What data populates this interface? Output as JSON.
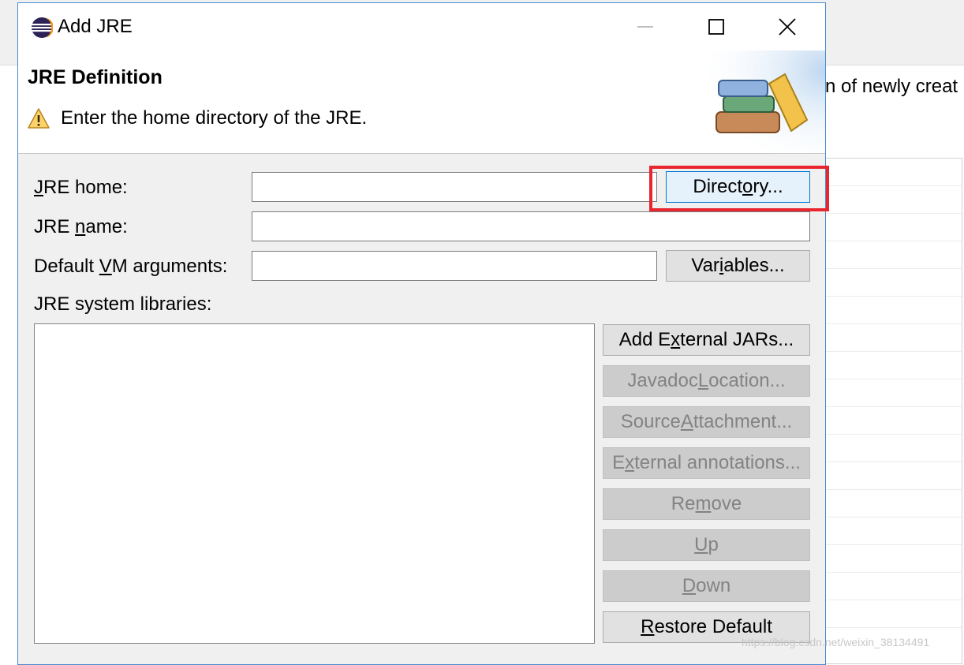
{
  "background": {
    "partial_text": "n of newly creat",
    "watermark": "https://blog.csdn.net/weixin_38134491"
  },
  "dialog": {
    "title": "Add JRE",
    "icons": {
      "app": "eclipse-icon",
      "minimize": "minimize-icon",
      "maximize": "maximize-icon",
      "close": "close-icon",
      "warning": "warning-icon",
      "header_graphic": "books-icon"
    },
    "header": {
      "title": "JRE Definition",
      "message": "Enter the home directory of the JRE."
    },
    "form": {
      "jre_home": {
        "label_pre": "",
        "label_mn": "J",
        "label_post": "RE home:",
        "value": ""
      },
      "jre_name": {
        "label_pre": "JRE ",
        "label_mn": "n",
        "label_post": "ame:",
        "value": ""
      },
      "vm_args": {
        "label_pre": "Default ",
        "label_mn": "V",
        "label_post": "M arguments:",
        "value": ""
      },
      "libraries_label": "JRE system libraries:"
    },
    "buttons": {
      "directory": {
        "pre": "Direct",
        "mn": "o",
        "post": "ry..."
      },
      "variables": {
        "pre": "Var",
        "mn": "i",
        "post": "ables..."
      },
      "add_external_jars": {
        "pre": "Add E",
        "mn": "x",
        "post": "ternal JARs..."
      },
      "javadoc_location": {
        "pre": "Javadoc ",
        "mn": "L",
        "post": "ocation..."
      },
      "source_attachment": {
        "pre": "Source ",
        "mn": "A",
        "post": "ttachment..."
      },
      "external_annotations": {
        "pre": "E",
        "mn": "x",
        "post": "ternal annotations..."
      },
      "remove": {
        "pre": "Re",
        "mn": "m",
        "post": "ove"
      },
      "up": {
        "pre": "",
        "mn": "U",
        "post": "p"
      },
      "down": {
        "pre": "",
        "mn": "D",
        "post": "own"
      },
      "restore_default": {
        "pre": "",
        "mn": "R",
        "post": "estore Default"
      }
    },
    "colors": {
      "highlight": "#e8262e",
      "focus_border": "#0078d7"
    }
  }
}
